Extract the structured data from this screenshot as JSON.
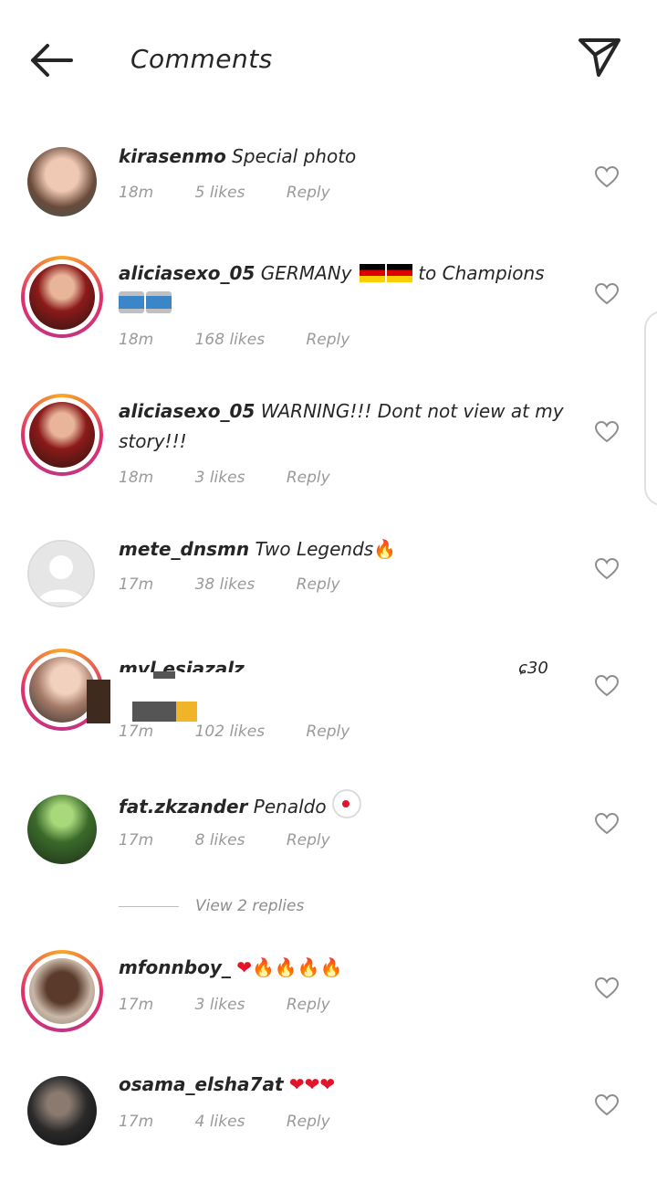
{
  "header": {
    "title": "Comments"
  },
  "comments": [
    {
      "username": "kirasenmo",
      "text": "Special photo",
      "time": "18m",
      "likes": "5 likes",
      "reply": "Reply"
    },
    {
      "username": "aliciasexo_05",
      "text": "GERMANy",
      "text2": "to Champions",
      "time": "18m",
      "likes": "168 likes",
      "reply": "Reply"
    },
    {
      "username": "aliciasexo_05",
      "text": "WARNING!!! Dont not view at my story!!!",
      "time": "18m",
      "likes": "3 likes",
      "reply": "Reply"
    },
    {
      "username": "mete_dnsmn",
      "text": "Two Legends",
      "time": "17m",
      "likes": "38 likes",
      "reply": "Reply"
    },
    {
      "username": "mvl.esiazalz",
      "text": "",
      "tail": "ɕ30",
      "time": "17m",
      "likes": "102 likes",
      "reply": "Reply"
    },
    {
      "username": "fat.zkzander",
      "text": "Penaldo",
      "time": "17m",
      "likes": "8 likes",
      "reply": "Reply"
    },
    {
      "username": "mfonnboy_",
      "text": "",
      "time": "17m",
      "likes": "3 likes",
      "reply": "Reply"
    },
    {
      "username": "osama_elsha7at",
      "text": "",
      "time": "17m",
      "likes": "4 likes",
      "reply": "Reply"
    }
  ],
  "view_replies": "View 2 replies",
  "icons": {
    "back": "arrow-left-icon",
    "send": "paper-plane-icon",
    "heart": "heart-outline-icon",
    "fire": "fire-emoji",
    "red_heart": "red-heart-emoji",
    "flag": "germany-flag-emoji",
    "drum": "drum-emoji",
    "clown": "clown-emoji"
  },
  "colors": {
    "ring_start": "#f9a825",
    "ring_end": "#c13584",
    "muted": "#9a9a9a",
    "text": "#262626"
  }
}
